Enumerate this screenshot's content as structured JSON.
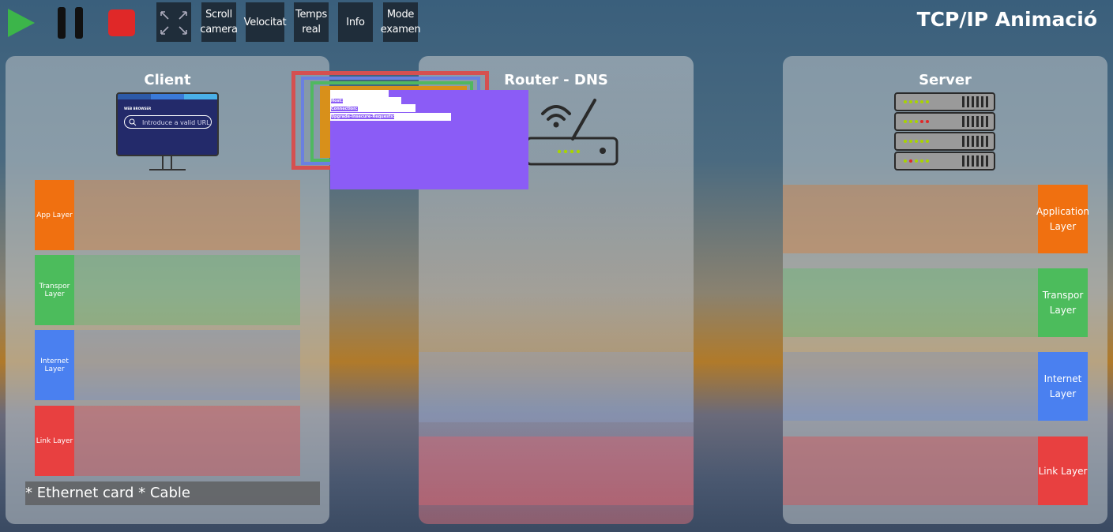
{
  "toolbar": {
    "play": "play-icon",
    "pause": "pause-icon",
    "stop": "stop-icon",
    "fullscreen": "expand-icon",
    "buttons": [
      "Scroll\ncamera",
      "Velocitat",
      "Temps\nreal",
      "Info",
      "Mode\nexamen"
    ]
  },
  "app_title": "TCP/IP Animació",
  "client": {
    "title": "Client",
    "browser_heading": "WEB BROWSER",
    "url_placeholder": "Introduce a valid URL",
    "layers": [
      "App Layer",
      "Transpor\nLayer",
      "Internet\nLayer",
      "Link Layer"
    ],
    "note": "* Ethernet card * Cable"
  },
  "router": {
    "title": "Router - DNS"
  },
  "server": {
    "title": "Server",
    "layers": [
      "Application\nLayer",
      "Transpor\nLayer",
      "Internet\nLayer",
      "Link Layer"
    ]
  },
  "packet": {
    "headers": [
      "Host:",
      "Connection:",
      "Upgrade-Insecure-Requests:"
    ]
  },
  "colors": {
    "app": "#f07010",
    "transport": "#4cbc5c",
    "internet": "#4a80f0",
    "link": "#e84040",
    "packet": "#8b5cf6"
  }
}
